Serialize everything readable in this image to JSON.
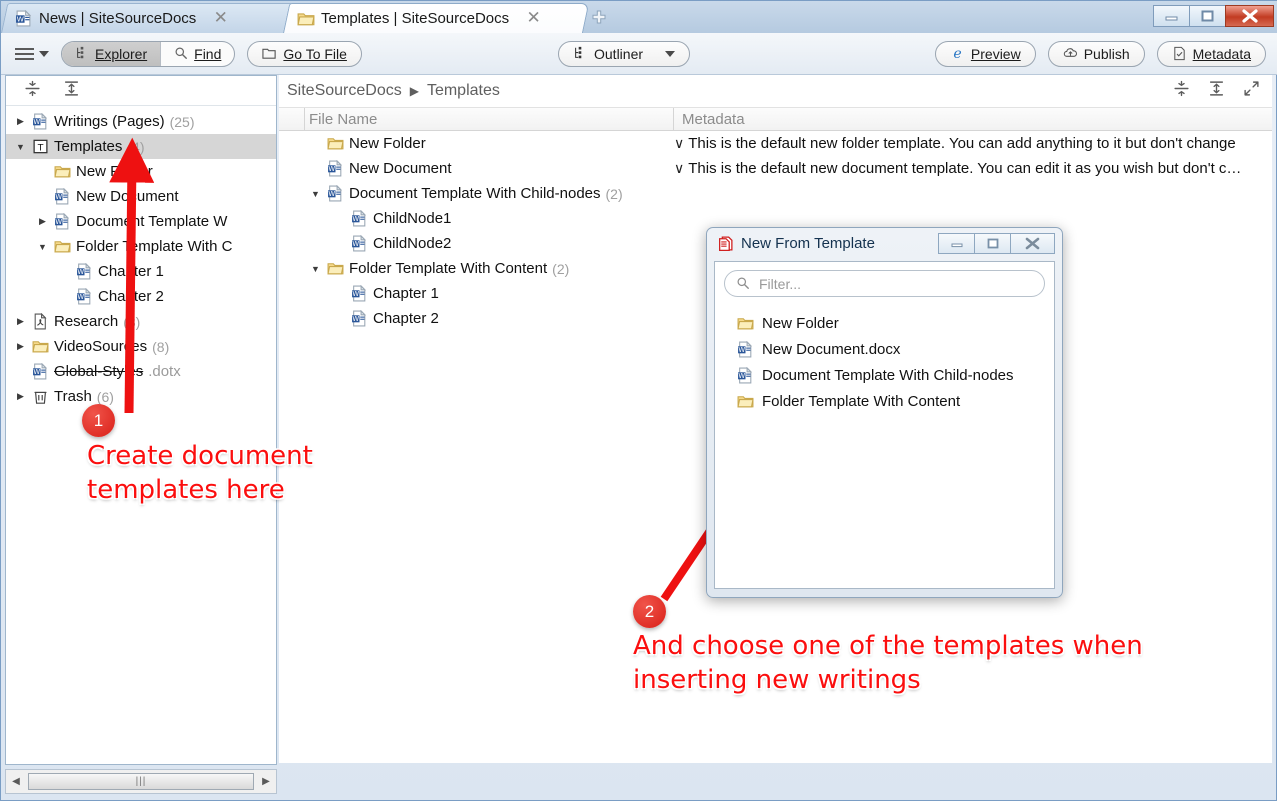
{
  "window": {
    "controls": {
      "minimize": "—",
      "maximize": "☐",
      "close": "✕"
    }
  },
  "tabs": [
    {
      "label": "News | SiteSourceDocs",
      "icon": "word-document-icon",
      "active": false,
      "close": "✕"
    },
    {
      "label": "Templates | SiteSourceDocs",
      "icon": "folder-icon",
      "active": true,
      "close": "✕"
    }
  ],
  "new_tab_label": "+",
  "toolbar": {
    "menu_label": "menu",
    "explorer_label": "Explorer",
    "find_label": "Find",
    "go_to_file_label": "Go To File",
    "outliner_label": "Outliner",
    "back_label": "←",
    "forward_label": "→",
    "preview_label": "Preview",
    "publish_label": "Publish",
    "metadata_label": "Metadata"
  },
  "sidebar": {
    "tools": [
      {
        "name": "collapse-all-icon"
      },
      {
        "name": "expand-all-icon"
      }
    ],
    "items": [
      {
        "label": "Writings (Pages)",
        "count": "(25)",
        "icon": "word-document-icon",
        "twisty": "▶",
        "indent": 0,
        "selected": false,
        "strike": false
      },
      {
        "label": "Templates",
        "count": "(4)",
        "icon": "template-icon",
        "twisty": "▼",
        "indent": 0,
        "selected": true,
        "strike": false
      },
      {
        "label": "New Folder",
        "count": "",
        "icon": "folder-icon",
        "twisty": "",
        "indent": 1,
        "selected": false,
        "strike": false
      },
      {
        "label": "New Document",
        "count": "",
        "icon": "word-document-icon",
        "twisty": "",
        "indent": 1,
        "selected": false,
        "strike": false
      },
      {
        "label": "Document Template W",
        "count": "",
        "icon": "word-document-icon",
        "twisty": "▶",
        "indent": 1,
        "selected": false,
        "strike": false
      },
      {
        "label": "Folder Template With C",
        "count": "",
        "icon": "folder-icon",
        "twisty": "▼",
        "indent": 1,
        "selected": false,
        "strike": false
      },
      {
        "label": "Chapter 1",
        "count": "",
        "icon": "word-document-icon",
        "twisty": "",
        "indent": 2,
        "selected": false,
        "strike": false
      },
      {
        "label": "Chapter 2",
        "count": "",
        "icon": "word-document-icon",
        "twisty": "",
        "indent": 2,
        "selected": false,
        "strike": false
      },
      {
        "label": "Research",
        "count": "(3)",
        "icon": "pdf-icon",
        "twisty": "▶",
        "indent": 0,
        "selected": false,
        "strike": false
      },
      {
        "label": "VideoSources",
        "count": "(8)",
        "icon": "folder-icon",
        "twisty": "▶",
        "indent": 0,
        "selected": false,
        "strike": false
      },
      {
        "label": "Global-Styles",
        "count": "",
        "ext": ".dotx",
        "icon": "word-document-icon",
        "twisty": "",
        "indent": 0,
        "selected": false,
        "strike": true
      },
      {
        "label": "Trash",
        "count": "(6)",
        "icon": "trash-icon",
        "twisty": "▶",
        "indent": 0,
        "selected": false,
        "strike": false
      }
    ],
    "scrollbar": {
      "left_arrow": "◀",
      "right_arrow": "▶",
      "grip": "|||"
    }
  },
  "main": {
    "breadcrumb": [
      "SiteSourceDocs",
      "Templates"
    ],
    "breadcrumb_separator": "▶",
    "columns": {
      "file_name": "File Name",
      "metadata": "Metadata"
    },
    "tools": [
      {
        "name": "collapse-all-icon"
      },
      {
        "name": "expand-all-icon"
      },
      {
        "name": "fullscreen-icon"
      }
    ],
    "rows": [
      {
        "name": "New Folder",
        "count": "",
        "icon": "folder-icon",
        "twisty": "",
        "indent": 0,
        "metadata": "This is the default new folder template. You can add anything to it but don't change",
        "check": "∨"
      },
      {
        "name": "New Document",
        "count": "",
        "icon": "word-document-icon",
        "twisty": "",
        "indent": 0,
        "metadata": "This is the default new document template. You can edit it as you wish but don't c…",
        "check": "∨"
      },
      {
        "name": "Document Template With Child-nodes",
        "count": "(2)",
        "icon": "word-document-icon",
        "twisty": "▼",
        "indent": 0,
        "metadata": "",
        "check": ""
      },
      {
        "name": "ChildNode1",
        "count": "",
        "icon": "word-document-icon",
        "twisty": "",
        "indent": 1,
        "metadata": "",
        "check": ""
      },
      {
        "name": "ChildNode2",
        "count": "",
        "icon": "word-document-icon",
        "twisty": "",
        "indent": 1,
        "metadata": "",
        "check": ""
      },
      {
        "name": "Folder Template With Content",
        "count": "(2)",
        "icon": "folder-icon",
        "twisty": "▼",
        "indent": 0,
        "metadata": "",
        "check": ""
      },
      {
        "name": "Chapter 1",
        "count": "",
        "icon": "word-document-icon",
        "twisty": "",
        "indent": 1,
        "metadata": "",
        "check": ""
      },
      {
        "name": "Chapter 2",
        "count": "",
        "icon": "word-document-icon",
        "twisty": "",
        "indent": 1,
        "metadata": "",
        "check": ""
      }
    ]
  },
  "dialog": {
    "title": "New From Template",
    "icon": "template-document-icon",
    "controls": {
      "minimize": "—",
      "maximize": "☐",
      "close": "✕"
    },
    "filter_placeholder": "Filter...",
    "filter_value": "",
    "items": [
      {
        "label": "New Folder",
        "icon": "folder-icon"
      },
      {
        "label": "New Document.docx",
        "icon": "word-document-icon"
      },
      {
        "label": "Document Template With Child-nodes",
        "icon": "word-document-icon"
      },
      {
        "label": "Folder Template With Content",
        "icon": "folder-icon"
      }
    ]
  },
  "annotations": {
    "accent_color": "#fb0e0e",
    "items": [
      {
        "number": "1",
        "text": "Create document\ntemplates here"
      },
      {
        "number": "2",
        "text": "And choose one of the templates when\ninserting new writings"
      }
    ]
  }
}
